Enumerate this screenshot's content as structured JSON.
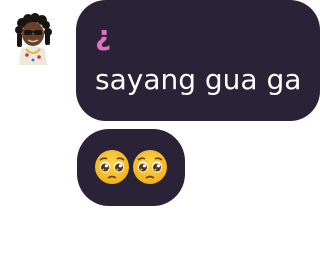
{
  "chat": {
    "sender": {
      "avatar_icon": "cartoon-character-avatar-icon"
    },
    "messages": [
      {
        "prefix": "¿",
        "text": "sayang gua ga"
      },
      {
        "emojis": [
          "pleading-face-icon",
          "pleading-face-icon"
        ]
      }
    ]
  },
  "colors": {
    "bubble": "#2a2236",
    "accent": "#df72c4",
    "text": "#ffffff",
    "background": "#ffffff"
  }
}
